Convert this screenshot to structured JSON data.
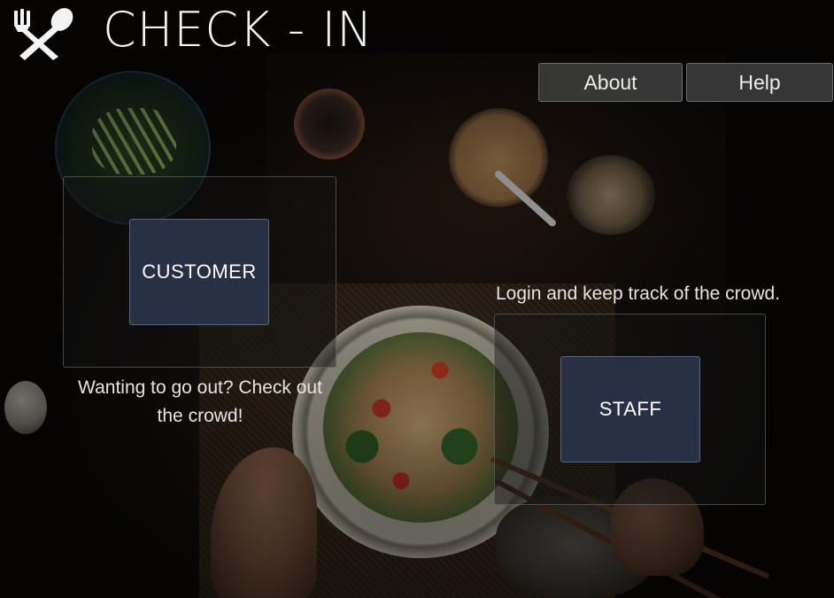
{
  "header": {
    "title": "CHECK - IN",
    "logo_icon": "fork-spoon-icon"
  },
  "nav": {
    "about": "About",
    "help": "Help"
  },
  "customer": {
    "button_label": "CUSTOMER",
    "caption": "Wanting to go out? Check out the crowd!"
  },
  "staff": {
    "button_label": "STAFF",
    "caption": "Login and keep track of the crowd."
  },
  "colors": {
    "role_button_bg": "#273044",
    "nav_button_bg": "#3e3e3e",
    "background": "#0b0907"
  }
}
